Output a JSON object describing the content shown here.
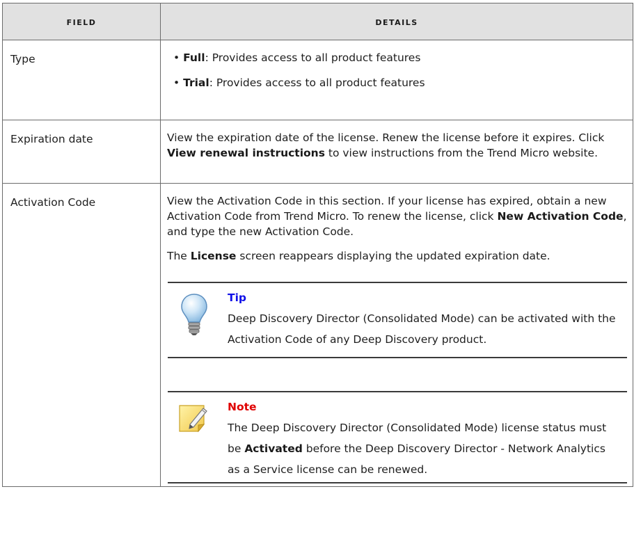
{
  "header": {
    "field": "Field",
    "details": "Details"
  },
  "rows": {
    "type": {
      "field": "Type",
      "bullets": [
        {
          "term": "Full",
          "text": ": Provides access to all product features"
        },
        {
          "term": "Trial",
          "text": ": Provides access to all product features"
        }
      ]
    },
    "expiration": {
      "field": "Expiration date",
      "p1": "View the expiration date of the license. Renew the license before it expires. Click ",
      "p1_bold": "View renewal instructions",
      "p1_end": " to view instructions from the Trend Micro website."
    },
    "activation": {
      "field": "Activation Code",
      "p1": "View the Activation Code in this section. If your license has expired, obtain a new Activation Code from Trend Micro. To renew the license, click ",
      "p1_bold": "New Activation Code",
      "p1_end": ", and type the new Activation Code.",
      "p2_start": "The ",
      "p2_bold": "License",
      "p2_end": " screen reappears displaying the updated expiration date.",
      "tip": {
        "title": "Tip",
        "icon": "lightbulb-icon",
        "body": "Deep Discovery Director (Consolidated Mode) can be activated with the Activation Code of any Deep Discovery product."
      },
      "note": {
        "title": "Note",
        "icon": "note-pencil-icon",
        "body_start": "The Deep Discovery Director (Consolidated Mode) license status must be ",
        "body_bold": "Activated",
        "body_end": " before the Deep Discovery Director - Network Analytics as a Service license can be renewed."
      }
    }
  },
  "colors": {
    "header_bg": "#e1e1e1",
    "tip_title": "#1010e8",
    "note_title": "#e00000"
  }
}
